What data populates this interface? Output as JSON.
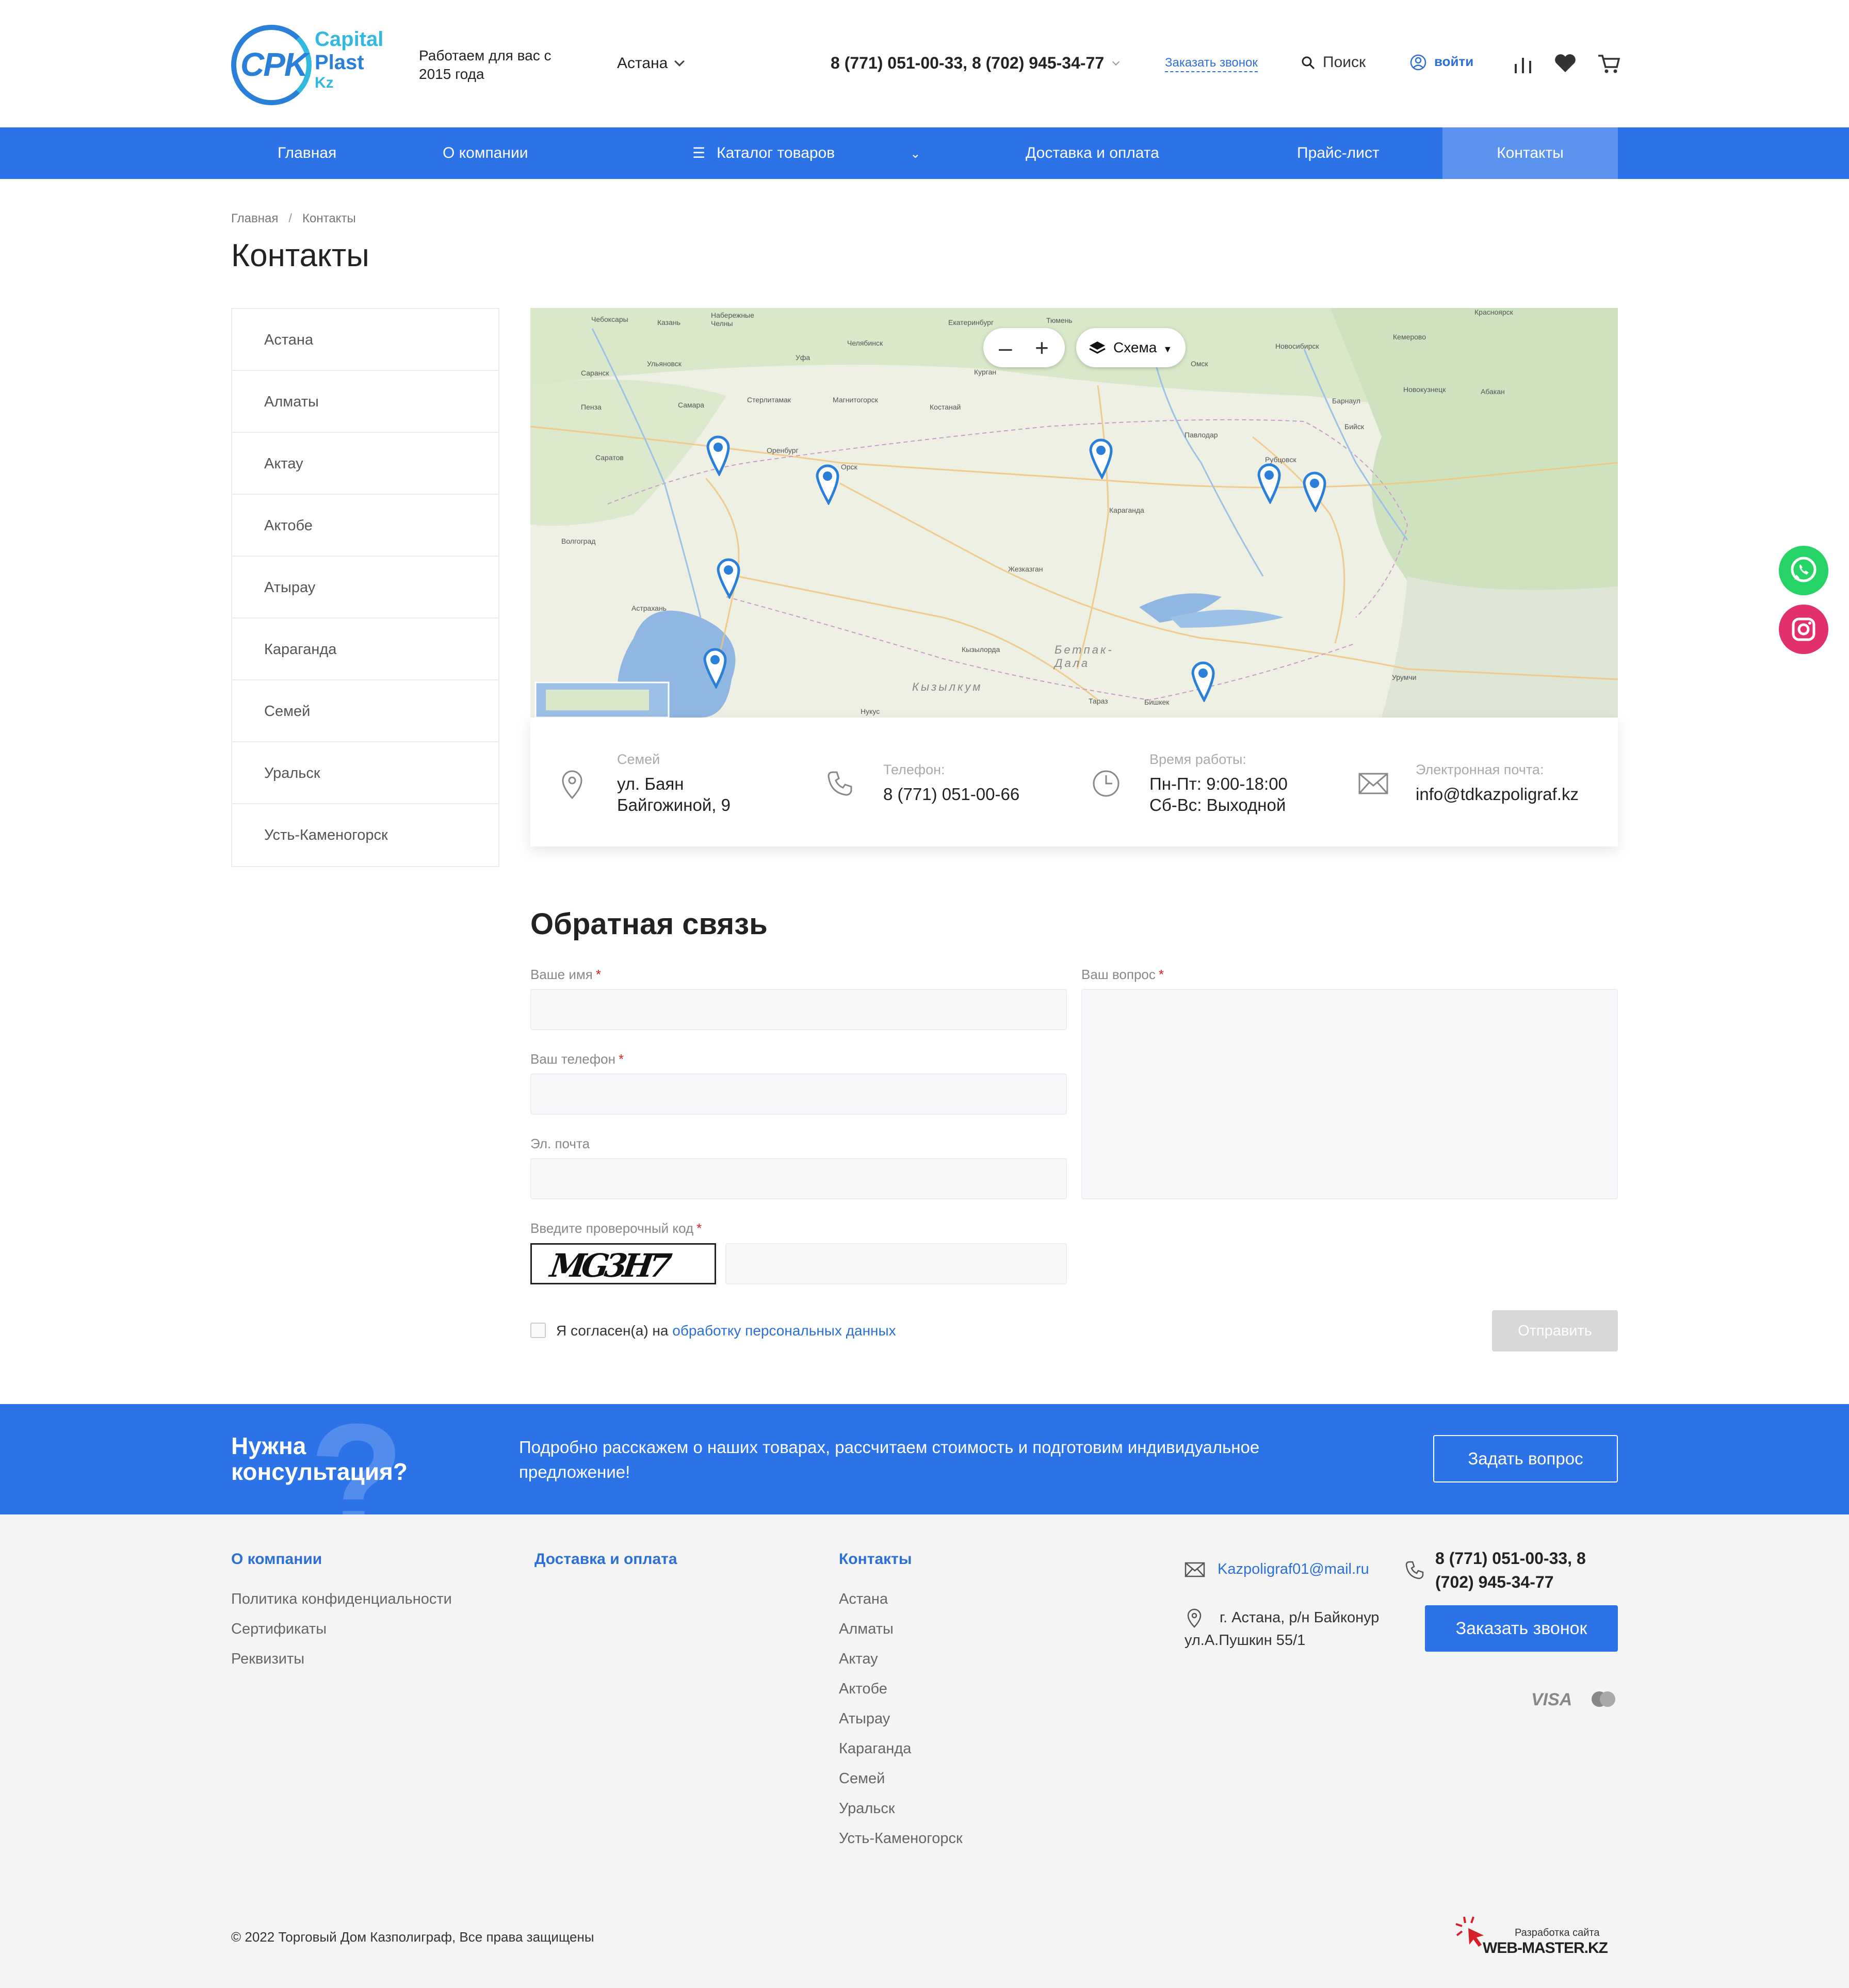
{
  "header": {
    "logo_lines": [
      "Capital",
      "Plast",
      "Kz"
    ],
    "logo_mark": "CPK",
    "work_since": "Работаем для вас с 2015 года",
    "city": "Астана",
    "phones": "8 (771) 051-00-33, 8 (702) 945-34-77",
    "callback_label": "Заказать звонок",
    "search_label": "Поиск",
    "login_label": "войти",
    "icons": [
      "search-icon",
      "user-icon",
      "compare-icon",
      "heart-icon",
      "cart-icon"
    ]
  },
  "nav": {
    "items": [
      "Главная",
      "О компании",
      "Каталог товаров",
      "Доставка и оплата",
      "Прайс-лист",
      "Контакты"
    ],
    "active": "Контакты"
  },
  "breadcrumb": [
    "Главная",
    "Контакты"
  ],
  "page_title": "Контакты",
  "cities": [
    "Астана",
    "Алматы",
    "Актау",
    "Актобе",
    "Атырау",
    "Караганда",
    "Семей",
    "Уральск",
    "Усть-Каменогорск"
  ],
  "map": {
    "type_label": "Схема",
    "zoom_out": "–",
    "zoom_in": "+",
    "labels": [
      "Чебоксары",
      "Казань",
      "Набережные Челны",
      "Екатеринбург",
      "Тюмень",
      "Курган",
      "Омск",
      "Новосибирск",
      "Красноярск",
      "Кемерово",
      "Саранск",
      "Ульяновск",
      "Уфа",
      "Челябинск",
      "Пенза",
      "Самара",
      "Стерлитамак",
      "Магнитогорск",
      "Костанай",
      "Барнаул",
      "Новокузнецк",
      "Абакан",
      "Саратов",
      "Оренбург",
      "Орск",
      "Павлодар",
      "Рубцовск",
      "Бийск",
      "Караганда",
      "Волгоград",
      "Жезказган",
      "Астрахань",
      "Кызылорда",
      "Бетпак-Дала",
      "Кызылкум",
      "Тараз",
      "Бишкек",
      "Урумчи",
      "Нукус"
    ]
  },
  "contact_card": {
    "address_label": "Семей",
    "address_value": [
      "ул. Баян",
      "Байгожиной, 9"
    ],
    "phone_label": "Телефон:",
    "phone_value": "8 (771) 051-00-66",
    "hours_label": "Время работы:",
    "hours_value": [
      "Пн-Пт: 9:00-18:00",
      "Сб-Вс: Выходной"
    ],
    "email_label": "Электронная почта:",
    "email_value": "info@tdkazpoligraf.kz"
  },
  "form": {
    "title": "Обратная связь",
    "name_label": "Ваше имя",
    "phone_label": "Ваш телефон",
    "email_label": "Эл. почта",
    "question_label": "Ваш вопрос",
    "captcha_label": "Введите проверочный код",
    "captcha_text": "MG3H7",
    "required_mark": "*",
    "consent_prefix": "Я согласен(а) на ",
    "consent_link": "обработку персональных данных",
    "submit_label": "Отправить"
  },
  "consult": {
    "title": "Нужна консультация?",
    "text": "Подробно расскажем о наших товарах, рассчитаем стоимость и подготовим индивидуальное предложение!",
    "button": "Задать вопрос"
  },
  "footer": {
    "col1_title": "О компании",
    "col1_links": [
      "Политика конфиденциальности",
      "Сертификаты",
      "Реквизиты"
    ],
    "col2_title": "Доставка и оплата",
    "col3_title": "Контакты",
    "col3_links": [
      "Астана",
      "Алматы",
      "Актау",
      "Актобе",
      "Атырау",
      "Караганда",
      "Семей",
      "Уральск",
      "Усть-Каменогорск"
    ],
    "email": "Kazpoligraf01@mail.ru",
    "address": "г. Астана, р/н Байконур ул.А.Пушкин 55/1",
    "phones": "8 (771) 051-00-33, 8 (702) 945-34-77",
    "callback_button": "Заказать звонок",
    "payment": [
      "VISA",
      "MasterCard"
    ],
    "copyright": "© 2022 Торговый Дом Казполиграф, Все права защищены",
    "dev_label": "Разработка сайта",
    "dev_name": "WEB-MASTER.KZ"
  },
  "colors": {
    "brand_blue": "#2c73e8",
    "nav_active": "#5b93ee",
    "link_blue": "#2c6fd6",
    "whatsapp": "#25d366",
    "instagram": "#e1306c"
  }
}
